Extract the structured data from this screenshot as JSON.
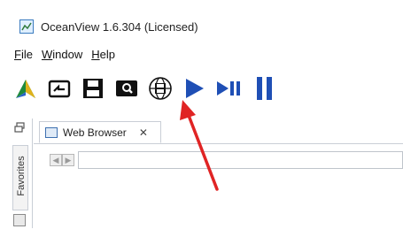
{
  "window": {
    "title": "OceanView 1.6.304 (Licensed)"
  },
  "menubar": {
    "items": [
      {
        "accel": "F",
        "rest": "ile"
      },
      {
        "accel": "W",
        "rest": "indow"
      },
      {
        "accel": "H",
        "rest": "elp"
      }
    ]
  },
  "toolbar": {
    "buttons": [
      {
        "icon": "spectrometer-icon"
      },
      {
        "icon": "open-folder-icon"
      },
      {
        "icon": "save-icon"
      },
      {
        "icon": "search-icon"
      },
      {
        "icon": "save-globe-icon"
      },
      {
        "icon": "play-icon"
      },
      {
        "icon": "step-icon"
      },
      {
        "icon": "pause-icon"
      }
    ],
    "accent_blue": "#1f4fb5",
    "highlight_color": "#e02424"
  },
  "sidebar": {
    "favorites_label": "Favorites"
  },
  "editor": {
    "tab_label": "Web Browser",
    "tab_close": "✕",
    "url_value": ""
  }
}
